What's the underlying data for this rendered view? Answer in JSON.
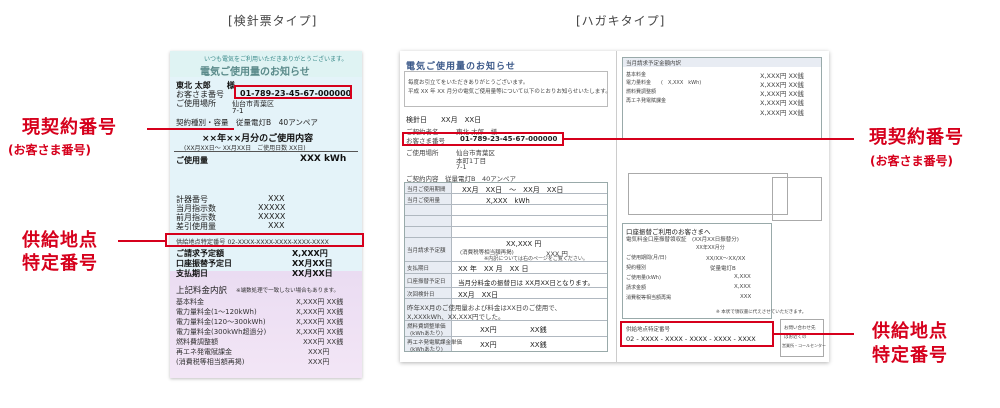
{
  "captions": {
    "slip": "[検針票タイプ]",
    "postcard": "[ハガキタイプ]"
  },
  "labels": {
    "contract_number": "現契約番号",
    "customer_number": "(お客さま番号)",
    "supply_point_line1": "供給地点",
    "supply_point_line2": "特定番号"
  },
  "slip": {
    "top_note": "いつも電気をご利用いただきありがとうございます。",
    "title": "電気ご使用量のお知らせ",
    "customer_name": "東北 太郎　　様",
    "customer_number_label": "お客さま番号",
    "customer_number": "01-789-23-45-67-000000",
    "place_label": "ご使用場所",
    "place_value": "仙台市青葉区",
    "place_value2": "7-1",
    "contract_type": "契約種別・容量　従量電灯B　40アンペア",
    "period_title": "××年××月分のご使用内容",
    "period_sub": "(XX月XX日～ XX月XX日　ご使用日数 XX日)",
    "usage_label": "ご使用量",
    "usage_value": "XXX kWh",
    "meter_rows": [
      {
        "label": "計器番号",
        "value": "XXX"
      },
      {
        "label": "当月指示数",
        "value": "XXXXX"
      },
      {
        "label": "前月指示数",
        "value": "XXXXX"
      },
      {
        "label": "差引使用量",
        "value": "XXX"
      }
    ],
    "supply_point_text": "供給地点特定番号 02-XXXX-XXXX-XXXX-XXXX-XXXX",
    "payment_rows": [
      {
        "label": "ご請求予定額",
        "value": "X,XXX円"
      },
      {
        "label": "口座振替予定日",
        "value": "XX月XX日"
      },
      {
        "label": "支払期日",
        "value": "XX月XX日"
      }
    ],
    "detail_title": "上記料金内訳",
    "detail_note": "※端数処理で一致しない場合もあります。",
    "detail_rows": [
      {
        "label": "基本料金",
        "value": "X,XXX円 XX銭"
      },
      {
        "label": "電力量料金(1～120kWh)",
        "value": "X,XXX円 XX銭"
      },
      {
        "label": "電力量料金(120～300kWh)",
        "value": "X,XXX円 XX銭"
      },
      {
        "label": "電力量料金(300kWh超過分)",
        "value": "X,XXX円 XX銭"
      },
      {
        "label": "燃料費調整額",
        "value": "XXX円 XX銭"
      },
      {
        "label": "再エネ発電賦課金",
        "value": "XXX円"
      },
      {
        "label": "(消費税等相当額再掲)",
        "value": "XXX円"
      }
    ]
  },
  "postcard": {
    "title": "電気ご使用量のお知らせ",
    "greeting1": "毎度お引立てをいただきありがとうございます。",
    "greeting2": "平成 XX 年 XX 月分の電気ご使用量等について以下のとおりお知らせいたします。",
    "meter_date": "検針日　　XX月　XX日",
    "customer_name_label": "ご契約者名",
    "customer_name": "東北 太郎　様",
    "customer_number_label": "お客さま番号",
    "customer_number": "01-789-23-45-67-000000",
    "place_label": "ご使用場所",
    "place_value1": "仙台市青葉区",
    "place_value2": "本町1丁目",
    "place_value3": "7-1",
    "contract_content": "ご契約内容　従量電灯B　40アンペア",
    "period_label": "当月ご使用期間",
    "period_value": "XX月　XX日　～　XX月　XX日",
    "usage_label": "当月ご使用量",
    "usage_value": "X,XXX　kWh",
    "billing_label": "当月請求予定額",
    "billing_value": "XX,XXX 円",
    "tax_label": "(消費税等相当額再掲)",
    "tax_value": "XXX 円",
    "billing_note": "※内訳については右のページをご覧ください。",
    "transfer_label": "支払期日",
    "transfer_value": "XX 年　XX 月　XX 日",
    "account_label": "口座振替予定日",
    "account_value": "当月分料金の振替日は XX月XX日となります。",
    "next_label": "次回検針日",
    "next_value": "XX月　XX日",
    "prev_text1": "昨年XX月のご使用量および料金はXX日のご使用で、",
    "prev_text2": "X,XXXkWh、XX,XXX円でした。",
    "fuel_label": "燃料費調整単価",
    "fuel_unit": "(kWhあたり)",
    "fuel_value": "XX円",
    "fuel_value2": "XX銭",
    "renew_label": "再エネ発電賦課金単価",
    "renew_unit": "(kWhあたり)",
    "renew_value": "XX円",
    "renew_value2": "XX銭",
    "right_header": "当月請求予定金額内訳",
    "right_rows": [
      {
        "label": "基本料金",
        "value": "X,XXX円 XX銭"
      },
      {
        "label": "電力量料金　　(　X,XXX　kWh)",
        "value": "X,XXX円 XX銭"
      },
      {
        "label": "燃料費調整額",
        "value": "X,XXX円 XX銭"
      },
      {
        "label": "再エネ発電賦課金",
        "value": "X,XXX円 XX銭"
      },
      {
        "label": "",
        "value": "X,XXX円 XX銭"
      }
    ],
    "account_box_title": "口座振替ご利用のお客さまへ",
    "account_box_sub": "電気料金口座振替領収証　(XX月XX日振替分)",
    "account_box_amount": "XX年XX月分",
    "account_box_rows": [
      {
        "label": "ご使用期間(月/日)",
        "value": "XX/XX～XX/XX"
      },
      {
        "label": "契約種別",
        "value": "従量電灯B"
      },
      {
        "label": "ご使用量(kWh)",
        "value": "X,XXX"
      },
      {
        "label": "請求金額",
        "value": "X,XXX"
      },
      {
        "label": "消費税等相当額再掲",
        "value": "XXX"
      }
    ],
    "account_box_note": "※ 本状で領収書に代えさせていただきます。",
    "supply_label": "供給地点特定番号",
    "supply_value": "02 - XXXX - XXXX - XXXX - XXXX - XXXX",
    "side_note1": "お問い合わせ先",
    "side_note2": "はお近くの",
    "side_note3": "営業所・コールセンター"
  },
  "colors": {
    "highlight": "#d6001c",
    "slip_bg": "#e4f3f9",
    "slip_lower_bg": "#eadcf2"
  }
}
